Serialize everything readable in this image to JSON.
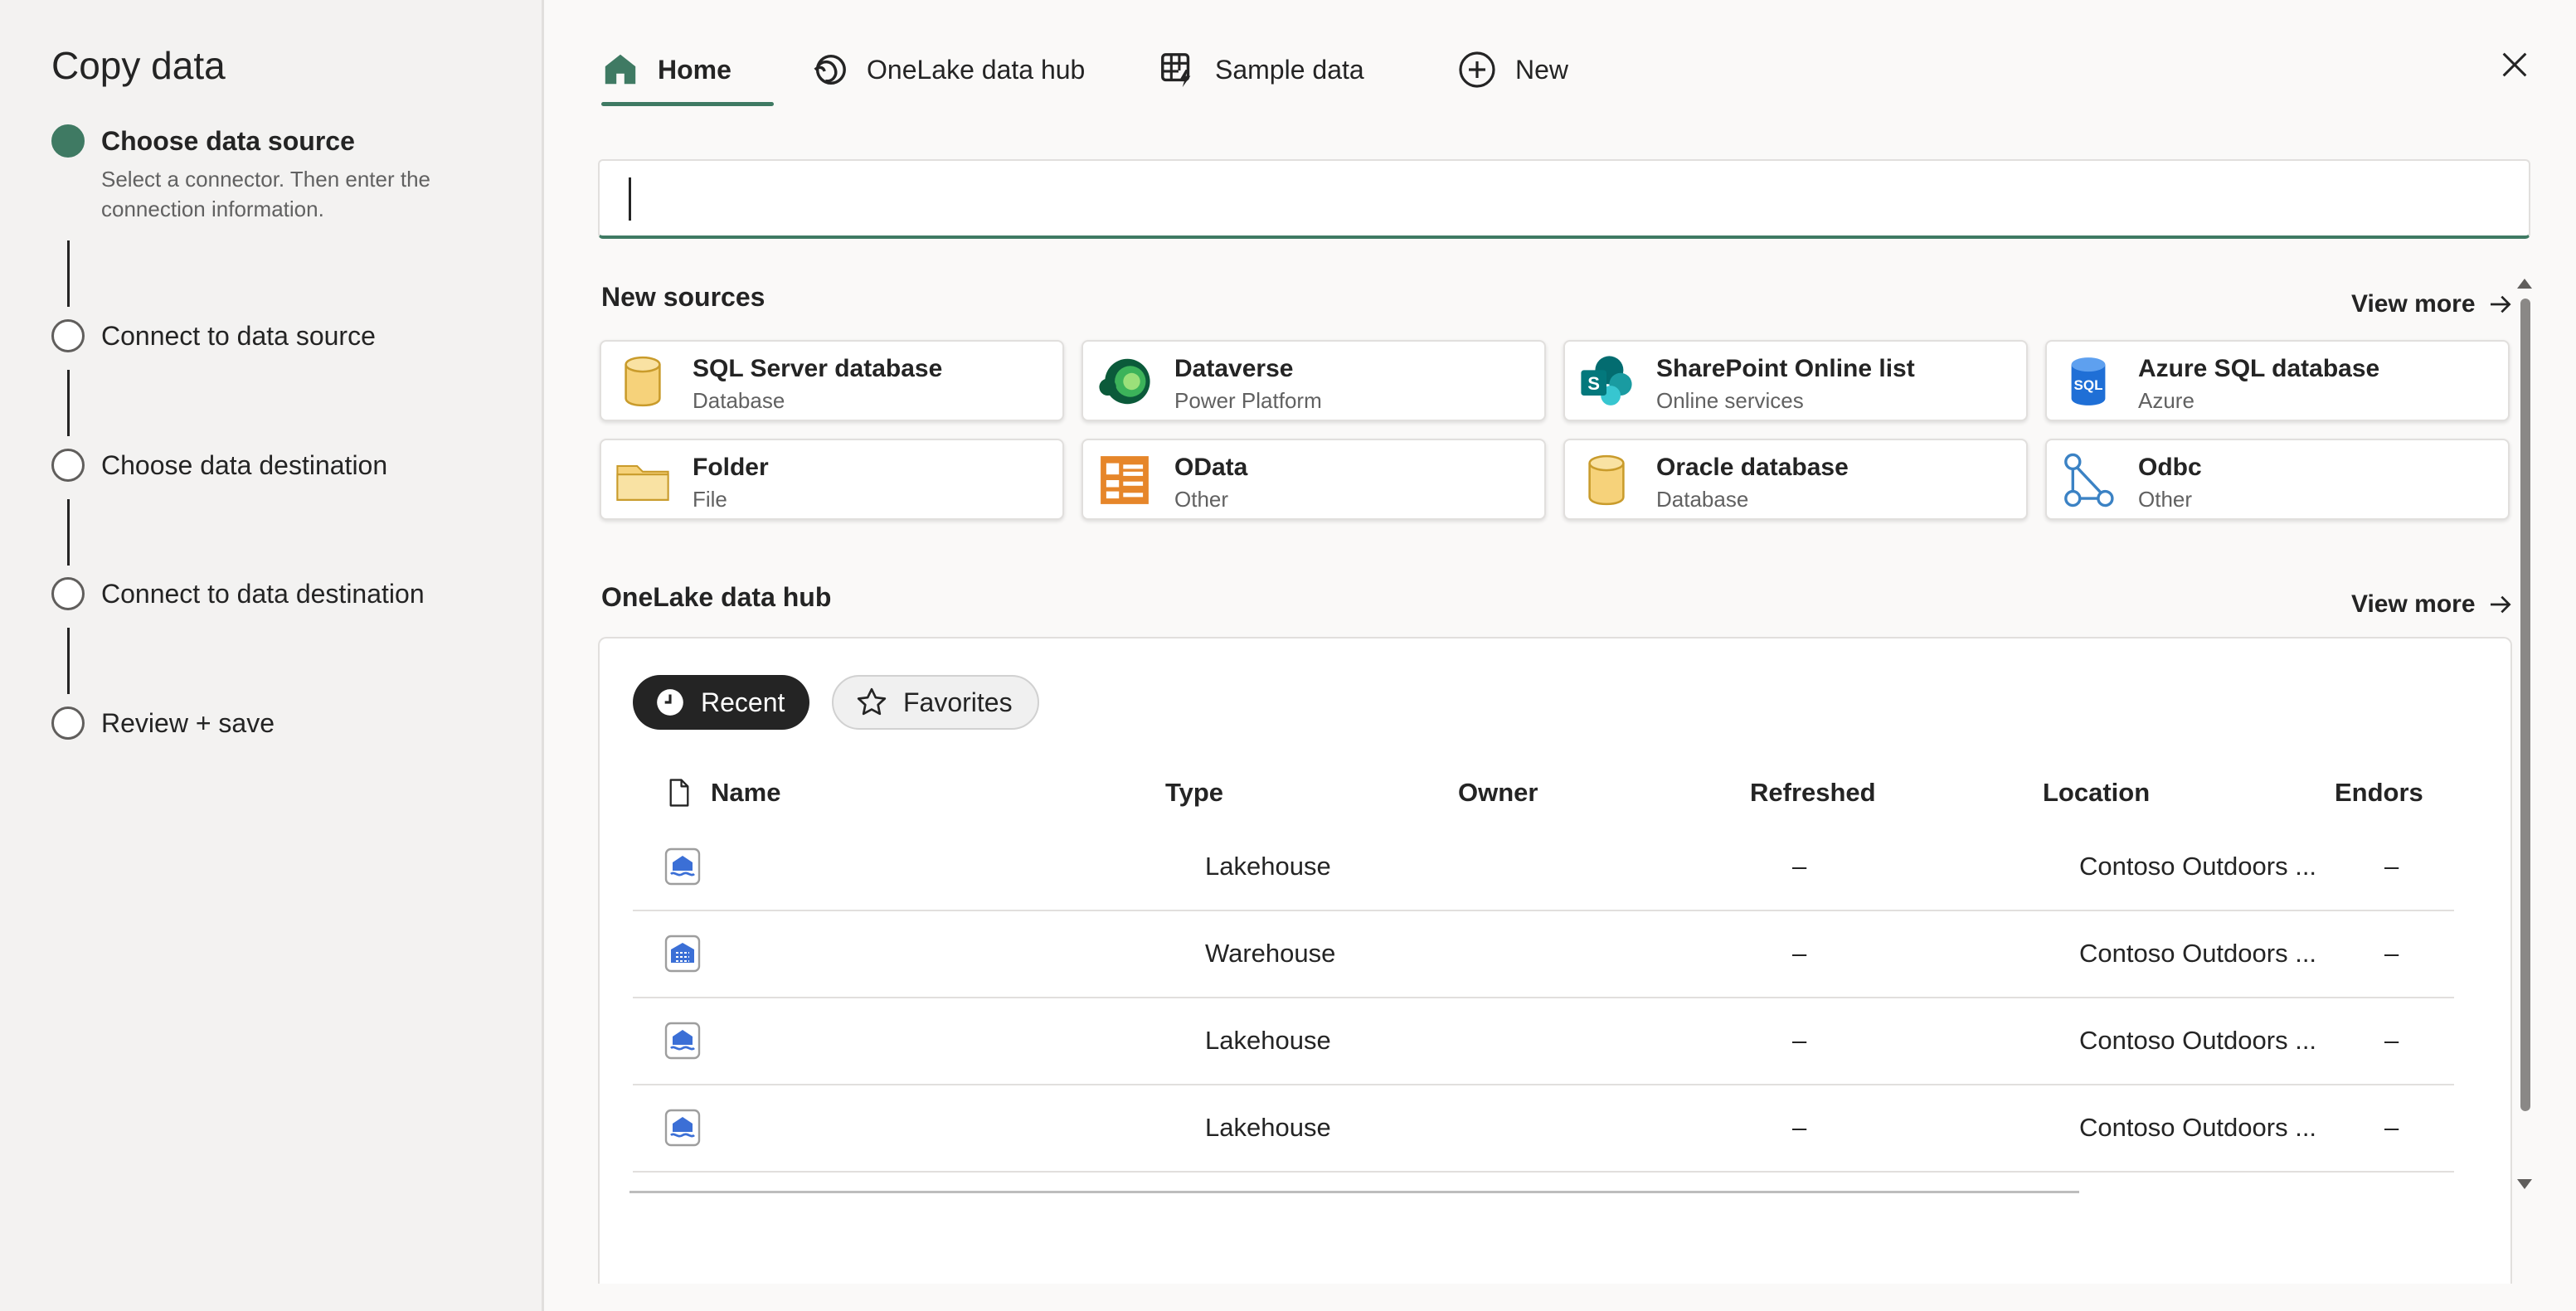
{
  "wizard": {
    "title": "Copy data",
    "steps": [
      {
        "label": "Choose data source",
        "description": "Select a connector. Then enter the connection information."
      },
      {
        "label": "Connect to data source"
      },
      {
        "label": "Choose data destination"
      },
      {
        "label": "Connect to data destination"
      },
      {
        "label": "Review + save"
      }
    ]
  },
  "tabs": [
    {
      "label": "Home",
      "icon": "home-icon"
    },
    {
      "label": "OneLake data hub",
      "icon": "onelake-icon"
    },
    {
      "label": "Sample data",
      "icon": "sample-data-icon"
    },
    {
      "label": "New",
      "icon": "add-circle-icon"
    }
  ],
  "search": {
    "value": "",
    "placeholder": ""
  },
  "new_sources": {
    "title": "New sources",
    "view_more": "View more",
    "items": [
      {
        "name": "SQL Server database",
        "type": "Database",
        "icon": "database-cylinder-icon"
      },
      {
        "name": "Dataverse",
        "type": "Power Platform",
        "icon": "dataverse-icon"
      },
      {
        "name": "SharePoint Online list",
        "type": "Online services",
        "icon": "sharepoint-icon"
      },
      {
        "name": "Azure SQL database",
        "type": "Azure",
        "icon": "azure-sql-icon"
      },
      {
        "name": "Folder",
        "type": "File",
        "icon": "folder-icon"
      },
      {
        "name": "OData",
        "type": "Other",
        "icon": "odata-icon"
      },
      {
        "name": "Oracle database",
        "type": "Database",
        "icon": "database-cylinder-icon"
      },
      {
        "name": "Odbc",
        "type": "Other",
        "icon": "odbc-icon"
      }
    ]
  },
  "hub": {
    "title": "OneLake data hub",
    "view_more": "View more",
    "filters": {
      "recent": "Recent",
      "favorites": "Favorites"
    },
    "columns": [
      "Name",
      "Type",
      "Owner",
      "Refreshed",
      "Location",
      "Endorse"
    ],
    "rows": [
      {
        "name": "",
        "type": "Lakehouse",
        "owner": "",
        "refreshed": "–",
        "location": "Contoso Outdoors ...",
        "endorsement": "–"
      },
      {
        "name": "",
        "type": "Warehouse",
        "owner": "",
        "refreshed": "–",
        "location": "Contoso Outdoors ...",
        "endorsement": "–"
      },
      {
        "name": "",
        "type": "Lakehouse",
        "owner": "",
        "refreshed": "–",
        "location": "Contoso Outdoors ...",
        "endorsement": "–"
      },
      {
        "name": "",
        "type": "Lakehouse",
        "owner": "",
        "refreshed": "–",
        "location": "Contoso Outdoors ...",
        "endorsement": "–"
      }
    ]
  },
  "colors": {
    "accent": "#3f7a63",
    "text": "#242424",
    "muted": "#616161"
  }
}
